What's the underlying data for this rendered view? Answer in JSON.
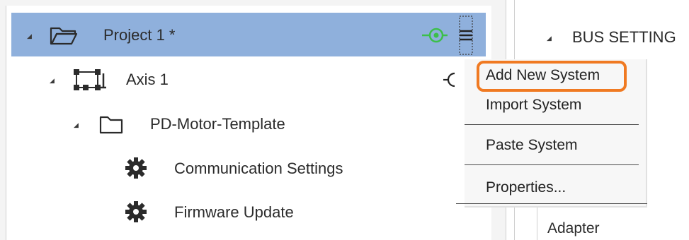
{
  "tree": {
    "project": {
      "label": "Project 1 *",
      "expanded": true,
      "selected": true
    },
    "axis": {
      "label": "Axis 1",
      "expanded": true
    },
    "template": {
      "label": "PD-Motor-Template",
      "expanded": true
    },
    "communication": {
      "label": "Communication Settings"
    },
    "firmware": {
      "label": "Firmware Update"
    }
  },
  "icons": {
    "folder": "folder-icon",
    "axis": "axis-node-icon",
    "gear": "gear-icon",
    "connect": "connect-icon",
    "menu": "menu-icon"
  },
  "context_menu": {
    "items": [
      "Add New System",
      "Import System",
      "Paste System",
      "Properties..."
    ]
  },
  "bus_settings": {
    "header": "BUS SETTING",
    "adapter_label": "Adapter"
  },
  "colors": {
    "selection": "#8fb0dc",
    "connect_icon": "#3cbf4a",
    "highlight_ring": "#f07a22"
  }
}
